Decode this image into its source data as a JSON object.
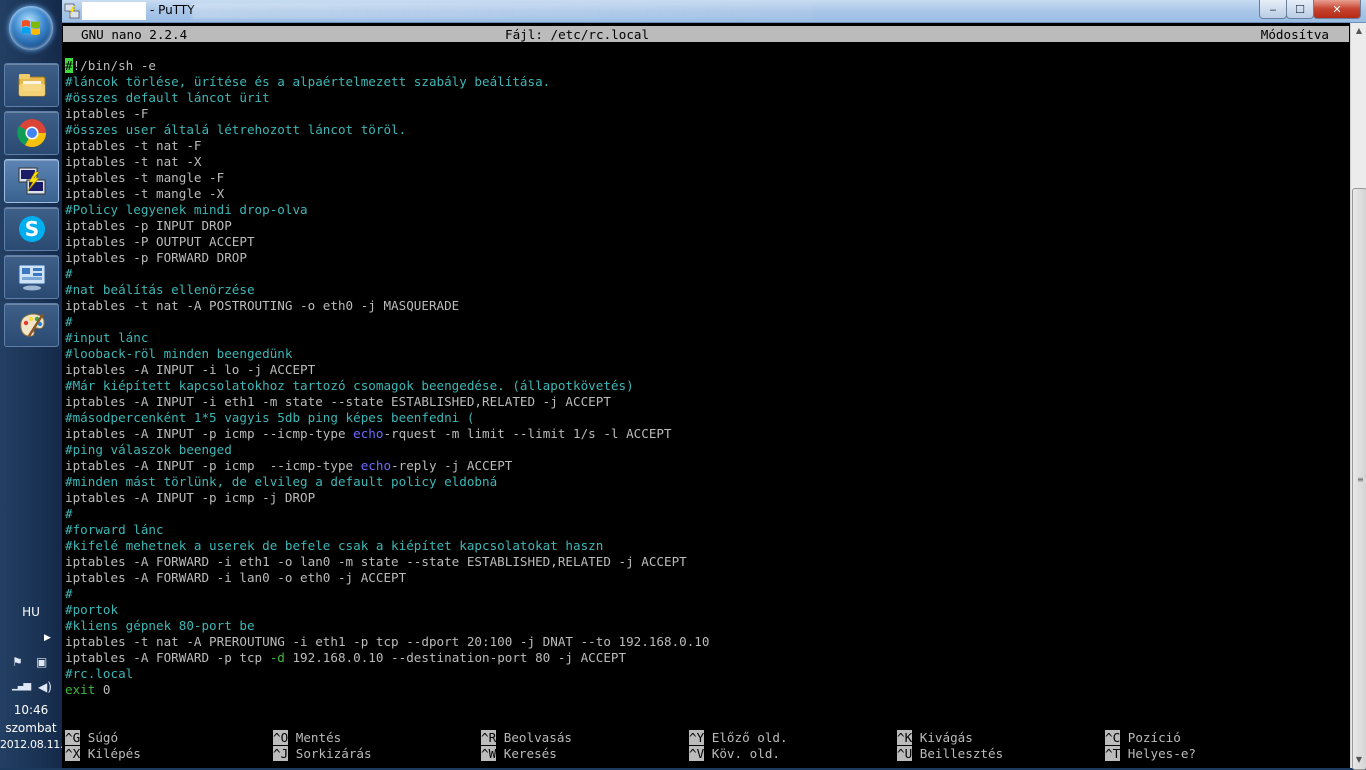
{
  "window": {
    "title": "- PuTTY",
    "controls": {
      "minimize": "‒",
      "maximize": "☐",
      "close": "✕"
    }
  },
  "taskbar": {
    "apps": [
      "explorer",
      "chrome",
      "putty",
      "skype",
      "control-panel",
      "paint"
    ],
    "language": "HU",
    "time": "10:46",
    "day": "szombat",
    "date": "2012.08.11."
  },
  "nano": {
    "version": "GNU nano 2.2.4",
    "file": "Fájl: /etc/rc.local",
    "status": "Módosítva"
  },
  "buffer_lines": [
    [
      {
        "c": "cursor",
        "t": "#"
      },
      {
        "c": "plain",
        "t": "!/bin/sh -e"
      }
    ],
    [
      {
        "c": "cmt",
        "t": "#láncok törlése, ürítése és a alpaértelmezett szabály beálítása."
      }
    ],
    [
      {
        "c": "cmt",
        "t": "#összes default láncot ürit"
      }
    ],
    [
      {
        "c": "plain",
        "t": "iptables -F"
      }
    ],
    [
      {
        "c": "cmt",
        "t": "#összes user általá létrehozott láncot töröl."
      }
    ],
    [
      {
        "c": "plain",
        "t": "iptables -t nat -F"
      }
    ],
    [
      {
        "c": "plain",
        "t": "iptables -t nat -X"
      }
    ],
    [
      {
        "c": "plain",
        "t": "iptables -t mangle -F"
      }
    ],
    [
      {
        "c": "plain",
        "t": "iptables -t mangle -X"
      }
    ],
    [
      {
        "c": "cmt",
        "t": "#Policy legyenek mindi drop-olva"
      }
    ],
    [
      {
        "c": "plain",
        "t": "iptables -p INPUT DROP"
      }
    ],
    [
      {
        "c": "plain",
        "t": "iptables -P OUTPUT ACCEPT"
      }
    ],
    [
      {
        "c": "plain",
        "t": "iptables -p FORWARD DROP"
      }
    ],
    [
      {
        "c": "cmt",
        "t": "#"
      }
    ],
    [
      {
        "c": "cmt",
        "t": "#nat beálítás ellenörzése"
      }
    ],
    [
      {
        "c": "plain",
        "t": "iptables -t nat -A POSTROUTING -o eth0 -j MASQUERADE"
      }
    ],
    [
      {
        "c": "cmt",
        "t": "#"
      }
    ],
    [
      {
        "c": "cmt",
        "t": "#input lánc"
      }
    ],
    [
      {
        "c": "cmt",
        "t": "#looback-röl minden beengedünk"
      }
    ],
    [
      {
        "c": "plain",
        "t": "iptables -A INPUT -i lo -j ACCEPT"
      }
    ],
    [
      {
        "c": "cmt",
        "t": "#Már kiépített kapcsolatokhoz tartozó csomagok beengedése. (állapotkövetés)"
      }
    ],
    [
      {
        "c": "plain",
        "t": "iptables -A INPUT -i eth1 -m state --state ESTABLISHED,RELATED -j ACCEPT"
      }
    ],
    [
      {
        "c": "cmt",
        "t": "#másodpercenként 1*5 vagyis 5db ping képes beenfedni ("
      }
    ],
    [
      {
        "c": "plain",
        "t": "iptables -A INPUT -p icmp --icmp-type "
      },
      {
        "c": "kw",
        "t": "echo"
      },
      {
        "c": "plain",
        "t": "-rquest -m limit --limit 1/s -l ACCEPT"
      }
    ],
    [
      {
        "c": "cmt",
        "t": "#ping válaszok beenged"
      }
    ],
    [
      {
        "c": "plain",
        "t": "iptables -A INPUT -p icmp  --icmp-type "
      },
      {
        "c": "kw",
        "t": "echo"
      },
      {
        "c": "plain",
        "t": "-reply -j ACCEPT"
      }
    ],
    [
      {
        "c": "cmt",
        "t": "#minden mást törlünk, de elvileg a default policy eldobná"
      }
    ],
    [
      {
        "c": "plain",
        "t": "iptables -A INPUT -p icmp -j DROP"
      }
    ],
    [
      {
        "c": "cmt",
        "t": "#"
      }
    ],
    [
      {
        "c": "cmt",
        "t": "#forward lánc"
      }
    ],
    [
      {
        "c": "cmt",
        "t": "#kifelé mehetnek a userek de befele csak a kiépítet kapcsolatokat haszn"
      }
    ],
    [
      {
        "c": "plain",
        "t": "iptables -A FORWARD -i eth1 -o lan0 -m state --state ESTABLISHED,RELATED -j ACCEPT"
      }
    ],
    [
      {
        "c": "plain",
        "t": "iptables -A FORWARD -i lan0 -o eth0 -j ACCEPT"
      }
    ],
    [
      {
        "c": "cmt",
        "t": "#"
      }
    ],
    [
      {
        "c": "cmt",
        "t": "#portok"
      }
    ],
    [
      {
        "c": "cmt",
        "t": "#kliens gépnek 80-port be"
      }
    ],
    [
      {
        "c": "plain",
        "t": "iptables -t nat -A PREROUTUNG -i eth1 -p tcp --dport 20:100 -j DNAT --to 192.168.0.10"
      }
    ],
    [
      {
        "c": "plain",
        "t": "iptables -A FORWARD -p tcp "
      },
      {
        "c": "grn",
        "t": "-d"
      },
      {
        "c": "plain",
        "t": " 192.168.0.10 --destination-port 80 -j ACCEPT"
      }
    ],
    [
      {
        "c": "cmt",
        "t": "#rc.local"
      }
    ],
    [
      {
        "c": "grn",
        "t": "exit"
      },
      {
        "c": "plain",
        "t": " 0"
      }
    ]
  ],
  "shortcuts": [
    {
      "key": "^G",
      "label": " Súgó"
    },
    {
      "key": "^O",
      "label": " Mentés"
    },
    {
      "key": "^R",
      "label": " Beolvasás"
    },
    {
      "key": "^Y",
      "label": " Előző old."
    },
    {
      "key": "^K",
      "label": " Kivágás"
    },
    {
      "key": "^C",
      "label": " Pozíció"
    },
    {
      "key": "^X",
      "label": " Kilépés"
    },
    {
      "key": "^J",
      "label": " Sorkizárás"
    },
    {
      "key": "^W",
      "label": " Keresés"
    },
    {
      "key": "^V",
      "label": " Köv. old."
    },
    {
      "key": "^U",
      "label": " Beillesztés"
    },
    {
      "key": "^T",
      "label": " Helyes-e?"
    }
  ]
}
